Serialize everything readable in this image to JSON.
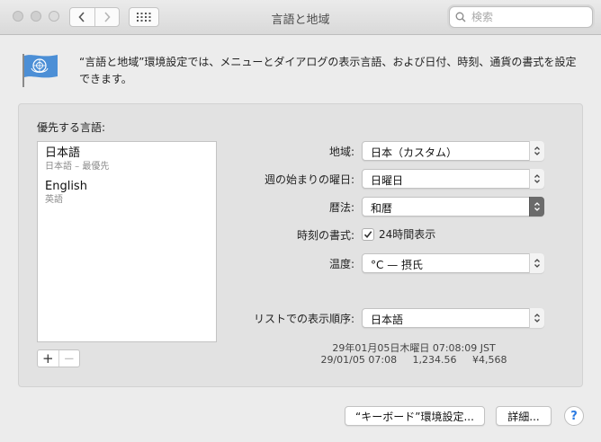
{
  "window": {
    "title": "言語と地域",
    "search_placeholder": "検索"
  },
  "header": {
    "description": "“言語と地域”環境設定では、メニューとダイアログの表示言語、および日付、時刻、通貨の書式を設定できます。"
  },
  "languages": {
    "heading": "優先する言語:",
    "items": [
      {
        "name": "日本語",
        "sub": "日本語 – 最優先"
      },
      {
        "name": "English",
        "sub": "英語"
      }
    ],
    "add_symbol": "+",
    "remove_symbol": "−"
  },
  "settings": {
    "region_label": "地域:",
    "region_value": "日本（カスタム）",
    "first_day_label": "週の始まりの曜日:",
    "first_day_value": "日曜日",
    "calendar_label": "暦法:",
    "calendar_value": "和暦",
    "time_format_label": "時刻の書式:",
    "time_format_check_label": "24時間表示",
    "time_format_checked": true,
    "temperature_label": "温度:",
    "temperature_value": "°C — 摂氏",
    "list_sort_label": "リストでの表示順序:",
    "list_sort_value": "日本語"
  },
  "samples": {
    "line1": "29年01月05日木曜日 07:08:09 JST",
    "line2": "29/01/05 07:08     1,234.56     ¥4,568"
  },
  "footer": {
    "keyboard_button": "“キーボード”環境設定...",
    "advanced_button": "詳細...",
    "help_symbol": "?"
  },
  "colors": {
    "accent": "#2a7ae2",
    "flag_blue": "#4c8fd6"
  }
}
